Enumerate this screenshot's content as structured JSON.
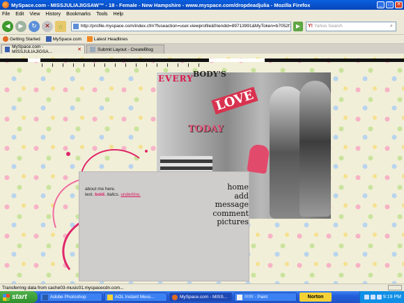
{
  "window": {
    "title": "MySpace.com - MISSJULIAJIGSAW™ - 18 - Female - New Hampshire - www.myspace.com/dropdeadjulia - Mozilla Firefox",
    "controls": [
      "_",
      "□",
      "✕"
    ]
  },
  "menu": [
    "File",
    "Edit",
    "View",
    "History",
    "Bookmarks",
    "Tools",
    "Help"
  ],
  "nav": {
    "url": "http://profile.myspace.com/index.cfm?fuseaction=user.viewprofile&friendid=89713991&MyToken=b7052f1-",
    "search_placeholder": "Yahoo Search",
    "search_logo": "Y!"
  },
  "bookmarks": [
    {
      "label": "Getting Started",
      "icon": "firefox-icon"
    },
    {
      "label": "MySpace.com",
      "icon": "myspace-icon"
    },
    {
      "label": "Latest Headlines",
      "icon": "rss-icon"
    }
  ],
  "tabs": [
    {
      "label": "MySpace.com - MISSJULIAJIGSA...",
      "active": true
    },
    {
      "label": "Submit Layout - CreateBlog",
      "active": false
    }
  ],
  "page": {
    "collage_words": {
      "every": "EVERY",
      "body": "BODY'S",
      "love": "LOVE",
      "today": "TODAY"
    },
    "about": {
      "line1": "about me here.",
      "text": "text.",
      "bold": "bold.",
      "italics": "italics.",
      "underline": "underline."
    },
    "nav_links": [
      "home",
      "add",
      "message",
      "comment",
      "pictures"
    ]
  },
  "status": "Transferring data from cache03-music01.myspacecdn.com...",
  "taskbar": {
    "start": "start",
    "tasks": [
      {
        "label": "Adobe Photoshop",
        "active": false
      },
      {
        "label": "AOL Instant Mess...",
        "active": false
      },
      {
        "label": "MySpace.com - MISS...",
        "active": true
      },
      {
        "label": "!!!!!!! - Paint",
        "active": false
      }
    ],
    "norton": "Norton",
    "clock": "9:19 PM"
  },
  "colors": {
    "accent_pink": "#d81b60",
    "xp_blue": "#245edb",
    "start_green": "#3c9a2c"
  }
}
